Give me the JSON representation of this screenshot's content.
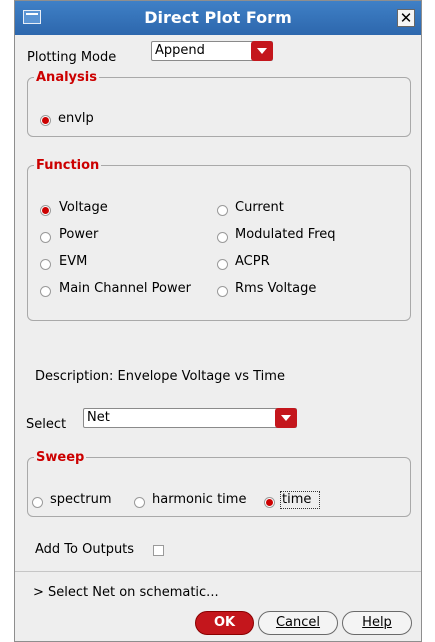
{
  "window": {
    "title": "Direct Plot Form"
  },
  "plotting_mode": {
    "label": "Plotting Mode",
    "value": "Append"
  },
  "analysis": {
    "legend": "Analysis",
    "options": [
      {
        "label": "envlp",
        "selected": true
      }
    ]
  },
  "function": {
    "legend": "Function",
    "options": [
      {
        "label": "Voltage",
        "selected": true
      },
      {
        "label": "Current",
        "selected": false
      },
      {
        "label": "Power",
        "selected": false
      },
      {
        "label": "Modulated Freq",
        "selected": false
      },
      {
        "label": "EVM",
        "selected": false
      },
      {
        "label": "ACPR",
        "selected": false
      },
      {
        "label": "Main Channel Power",
        "selected": false
      },
      {
        "label": "Rms Voltage",
        "selected": false
      }
    ]
  },
  "description": "Description: Envelope Voltage vs Time",
  "select": {
    "label": "Select",
    "value": "Net"
  },
  "sweep": {
    "legend": "Sweep",
    "options": [
      {
        "label": "spectrum",
        "selected": false
      },
      {
        "label": "harmonic time",
        "selected": false
      },
      {
        "label": "time",
        "selected": true
      }
    ]
  },
  "add_to_outputs": {
    "label": "Add To Outputs",
    "checked": false
  },
  "status": "> Select Net on schematic...",
  "buttons": {
    "ok": "OK",
    "cancel": "Cancel",
    "help": "Help"
  },
  "colors": {
    "accent": "#c4161c",
    "titlebar": "#2d67ad",
    "legend": "#cc0000"
  }
}
